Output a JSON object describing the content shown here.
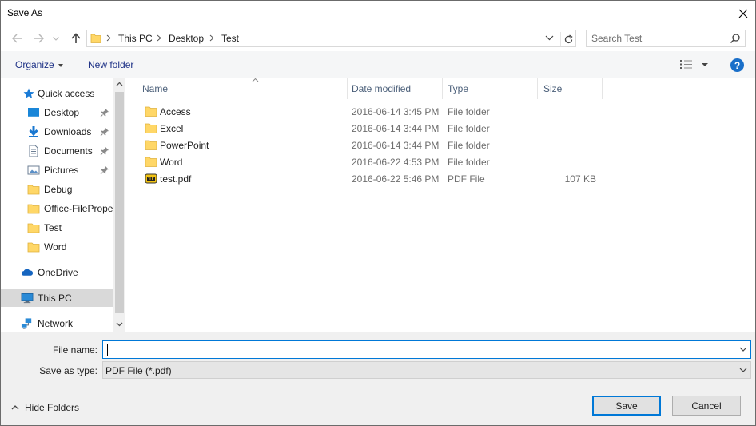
{
  "window": {
    "title": "Save As"
  },
  "address": {
    "breadcrumbs": [
      "This PC",
      "Desktop",
      "Test"
    ]
  },
  "search": {
    "placeholder": "Search Test"
  },
  "toolbar": {
    "organize_label": "Organize",
    "new_folder_label": "New folder",
    "help_label": "?"
  },
  "sidebar": {
    "items": [
      {
        "label": "Quick access",
        "icon": "star-icon",
        "pinned": false
      },
      {
        "label": "Desktop",
        "icon": "desktop-icon",
        "pinned": true
      },
      {
        "label": "Downloads",
        "icon": "download-icon",
        "pinned": true
      },
      {
        "label": "Documents",
        "icon": "document-icon",
        "pinned": true
      },
      {
        "label": "Pictures",
        "icon": "picture-icon",
        "pinned": true
      },
      {
        "label": "Debug",
        "icon": "folder-icon",
        "pinned": false
      },
      {
        "label": "Office-FileProperties",
        "icon": "folder-icon",
        "pinned": false
      },
      {
        "label": "Test",
        "icon": "folder-icon",
        "pinned": false
      },
      {
        "label": "Word",
        "icon": "folder-icon",
        "pinned": false
      },
      {
        "label": "OneDrive",
        "icon": "cloud-icon",
        "pinned": false
      },
      {
        "label": "This PC",
        "icon": "computer-icon",
        "pinned": false,
        "selected": true
      },
      {
        "label": "Network",
        "icon": "network-icon",
        "pinned": false
      }
    ]
  },
  "files": {
    "columns": [
      "Name",
      "Date modified",
      "Type",
      "Size"
    ],
    "rows": [
      {
        "name": "Access",
        "date": "2016-06-14 3:45 PM",
        "type": "File folder",
        "size": "",
        "icon": "folder-icon"
      },
      {
        "name": "Excel",
        "date": "2016-06-14 3:44 PM",
        "type": "File folder",
        "size": "",
        "icon": "folder-icon"
      },
      {
        "name": "PowerPoint",
        "date": "2016-06-14 3:44 PM",
        "type": "File folder",
        "size": "",
        "icon": "folder-icon"
      },
      {
        "name": "Word",
        "date": "2016-06-22 4:53 PM",
        "type": "File folder",
        "size": "",
        "icon": "folder-icon"
      },
      {
        "name": "test.pdf",
        "date": "2016-06-22 5:46 PM",
        "type": "PDF File",
        "size": "107 KB",
        "icon": "pdf-icon"
      }
    ]
  },
  "form": {
    "file_name_label": "File name:",
    "file_name_value": "",
    "save_as_type_label": "Save as type:",
    "save_as_type_value": "PDF File (*.pdf)"
  },
  "footer": {
    "hide_folders_label": "Hide Folders",
    "save_label": "Save",
    "cancel_label": "Cancel"
  },
  "colors": {
    "accent": "#0078d7",
    "toolbar_bg": "#f5f6f7",
    "bottom_bg": "#f0f0f0",
    "folder": "#ffd767"
  }
}
